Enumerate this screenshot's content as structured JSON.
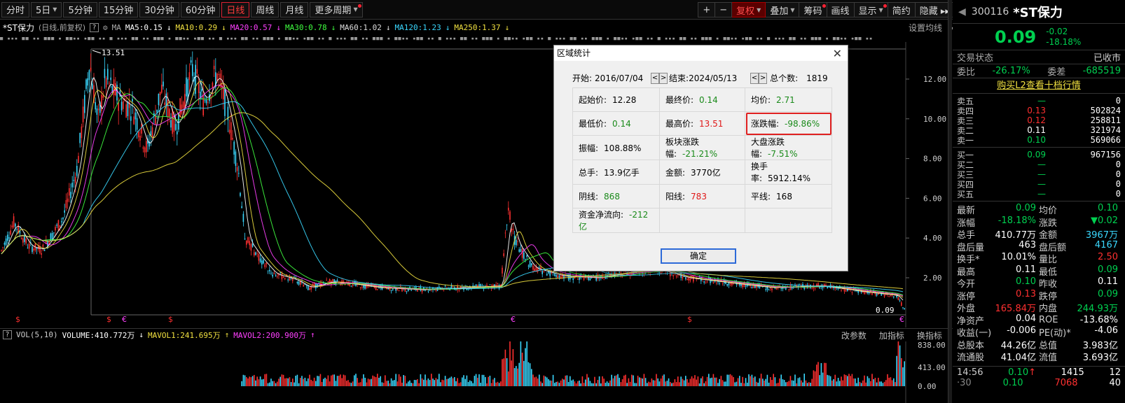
{
  "toolbar": {
    "periods": [
      "分时",
      "5日",
      "5分钟",
      "15分钟",
      "30分钟",
      "60分钟",
      "日线",
      "周线",
      "月线",
      "更多周期"
    ],
    "active_period": "日线",
    "right_buttons": [
      "+",
      "−",
      "复权",
      "叠加",
      "筹码",
      "画线",
      "显示",
      "简约",
      "隐藏 ▸▸",
      "⛶"
    ]
  },
  "ma_line": {
    "stock": "*ST保力",
    "type": "(日线,前复权)",
    "q": "?",
    "ma_label": "MA",
    "items": [
      {
        "text": "MA5:0.15",
        "color": "#ffffff"
      },
      {
        "text": "MA10:0.29",
        "color": "#f0e040"
      },
      {
        "text": "MA20:0.57",
        "color": "#ff40ff"
      },
      {
        "text": "MA30:0.78",
        "color": "#40ff40"
      },
      {
        "text": "MA60:1.02",
        "color": "#dddddd"
      },
      {
        "text": "MA120:1.23",
        "color": "#3ad8ff"
      },
      {
        "text": "MA250:1.37",
        "color": "#f0e040"
      }
    ],
    "settings": "设置均线"
  },
  "chart": {
    "high_label": "13.51",
    "low_label": "0.09",
    "yticks": [
      "12.00",
      "10.00",
      "8.00",
      "6.00",
      "4.00",
      "2.00"
    ],
    "vol_yticks": [
      "838.00",
      "413.00",
      "0.00"
    ]
  },
  "vol_line": {
    "label": "VOL(5,10)",
    "volume": "VOLUME:410.772万",
    "mavol1": "MAVOL1:241.695万",
    "mavol2": "MAVOL2:200.900万",
    "tools": [
      "改参数",
      "加指标",
      "换指标",
      "⊠"
    ]
  },
  "panel": {
    "code": "300116",
    "name": "*ST保力",
    "price": "0.09",
    "change": "-0.02",
    "change_pct": "-18.18%",
    "status_label": "交易状态",
    "status_value": "已收市",
    "weibi_label": "委比",
    "weibi_value": "-26.17%",
    "weicha_label": "委差",
    "weicha_value": "-685519",
    "l2_link": "购买L2查看十档行情",
    "asks": [
      {
        "label": "卖五",
        "price": "—",
        "vol": "0"
      },
      {
        "label": "卖四",
        "price": "0.13",
        "vol": "502824"
      },
      {
        "label": "卖三",
        "price": "0.12",
        "vol": "258811"
      },
      {
        "label": "卖二",
        "price": "0.11",
        "vol": "321974"
      },
      {
        "label": "卖一",
        "price": "0.10",
        "vol": "569066"
      }
    ],
    "bids": [
      {
        "label": "买一",
        "price": "0.09",
        "vol": "967156"
      },
      {
        "label": "买二",
        "price": "—",
        "vol": "0"
      },
      {
        "label": "买三",
        "price": "—",
        "vol": "0"
      },
      {
        "label": "买四",
        "price": "—",
        "vol": "0"
      },
      {
        "label": "买五",
        "price": "—",
        "vol": "0"
      }
    ],
    "stats": [
      [
        {
          "k": "最新",
          "v": "0.09",
          "c": "green"
        },
        {
          "k": "均价",
          "v": "0.10",
          "c": "green"
        }
      ],
      [
        {
          "k": "涨幅",
          "v": "-18.18%",
          "c": "green"
        },
        {
          "k": "涨跌",
          "v": "▼0.02",
          "c": "green"
        }
      ],
      [
        {
          "k": "总手",
          "v": "410.77万",
          "c": "white"
        },
        {
          "k": "金额",
          "v": "3967万",
          "c": "cyan"
        }
      ],
      [
        {
          "k": "盘后量",
          "v": "463",
          "c": "white"
        },
        {
          "k": "盘后额",
          "v": "4167",
          "c": "cyan"
        }
      ],
      [
        {
          "k": "换手*",
          "v": "10.01%",
          "c": "white"
        },
        {
          "k": "量比",
          "v": "2.50",
          "c": "red"
        }
      ],
      [
        {
          "k": "最高",
          "v": "0.11",
          "c": "white"
        },
        {
          "k": "最低",
          "v": "0.09",
          "c": "green"
        }
      ],
      [
        {
          "k": "今开",
          "v": "0.10",
          "c": "green"
        },
        {
          "k": "昨收",
          "v": "0.11",
          "c": "white"
        }
      ],
      [
        {
          "k": "涨停",
          "v": "0.13",
          "c": "red"
        },
        {
          "k": "跌停",
          "v": "0.09",
          "c": "green"
        }
      ],
      [
        {
          "k": "外盘",
          "v": "165.84万",
          "c": "red"
        },
        {
          "k": "内盘",
          "v": "244.93万",
          "c": "green"
        }
      ],
      [
        {
          "k": "净资产",
          "v": "0.04",
          "c": "white"
        },
        {
          "k": "ROE",
          "v": "-13.68%",
          "c": "white"
        }
      ],
      [
        {
          "k": "收益(一)",
          "v": "-0.006",
          "c": "white"
        },
        {
          "k": "PE(动)*",
          "v": "-4.06",
          "c": "white"
        }
      ],
      [
        {
          "k": "总股本",
          "v": "44.26亿",
          "c": "white"
        },
        {
          "k": "总值",
          "v": "3.983亿",
          "c": "white"
        }
      ],
      [
        {
          "k": "流通股",
          "v": "41.04亿",
          "c": "white"
        },
        {
          "k": "流值",
          "v": "3.693亿",
          "c": "white"
        }
      ]
    ],
    "tick": {
      "time": "14:56",
      "price": "0.10",
      "vol": "1415",
      "n": "12"
    },
    "tick2": {
      "time": "·30",
      "price": "0.10",
      "vol": "7068",
      "n": "40"
    }
  },
  "dialog": {
    "title": "区域统计",
    "start_label": "开始:",
    "start_date": "2016/07/04",
    "end_label": "结束:",
    "end_date": "2024/05/13",
    "count_label": "总个数:",
    "count": "1819",
    "rows": [
      [
        {
          "k": "起始价:",
          "v": "12.28",
          "c": ""
        },
        {
          "k": "最终价:",
          "v": "0.14",
          "c": "d-green"
        },
        {
          "k": "均价:",
          "v": "2.71",
          "c": "d-green"
        }
      ],
      [
        {
          "k": "最低价:",
          "v": "0.14",
          "c": "d-green"
        },
        {
          "k": "最高价:",
          "v": "13.51",
          "c": "d-red"
        },
        {
          "k": "涨跌幅:",
          "v": "-98.86%",
          "c": "d-green"
        }
      ],
      [
        {
          "k": "振幅:",
          "v": "108.88%",
          "c": ""
        },
        {
          "k": "板块涨跌幅:",
          "v": "-21.21%",
          "c": "d-green"
        },
        {
          "k": "大盘涨跌幅:",
          "v": "-7.51%",
          "c": "d-green"
        }
      ],
      [
        {
          "k": "总手:",
          "v": "13.9亿手",
          "c": ""
        },
        {
          "k": "金额:",
          "v": "3770亿",
          "c": ""
        },
        {
          "k": "换手率:",
          "v": "5912.14%",
          "c": ""
        }
      ],
      [
        {
          "k": "阴线:",
          "v": "868",
          "c": "d-green"
        },
        {
          "k": "阳线:",
          "v": "783",
          "c": "d-red"
        },
        {
          "k": "平线:",
          "v": "168",
          "c": ""
        }
      ],
      [
        {
          "k": "资金净流向:",
          "v": "-212亿",
          "c": "d-green"
        },
        {
          "k": "",
          "v": "",
          "c": ""
        },
        {
          "k": "",
          "v": "",
          "c": ""
        }
      ]
    ],
    "ok": "确定"
  }
}
